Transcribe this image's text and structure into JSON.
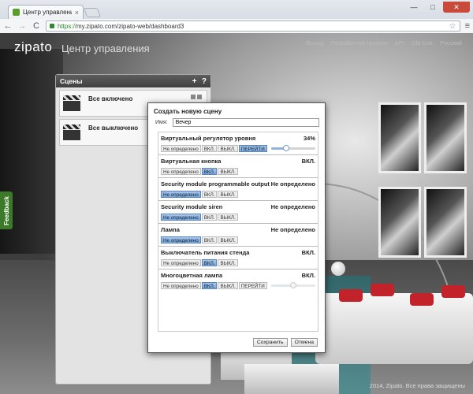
{
  "browser": {
    "tab_title": "Центр управления",
    "tab_close": "×",
    "window_controls": [
      "—",
      "□",
      "✕"
    ],
    "nav": {
      "back": "←",
      "forward": "→",
      "reload": "C"
    },
    "url_scheme": "https://",
    "url_rest": "my.zipato.com/zipato-web/dashboard3",
    "star": "☆",
    "menu": "≡"
  },
  "header": {
    "logo": "zipato",
    "subtitle": "Центр управления",
    "nav": [
      "Выход",
      "Разработчик прилож",
      "API",
      "Old look",
      "Русский"
    ]
  },
  "feedback_label": "Feedback",
  "scenes_panel": {
    "title": "Сцены",
    "add_icon": "+",
    "help_icon": "?",
    "items": [
      {
        "name": "Все включено"
      },
      {
        "name": "Все выключено"
      }
    ]
  },
  "dialog": {
    "title": "Создать новую сцену",
    "name_label": "Имя:",
    "name_value": "Вечер",
    "devices": [
      {
        "name": "Виртуальный регулятор уровня",
        "state": "34%",
        "buttons": [
          "Не определено",
          "ВКЛ.",
          "ВЫКЛ.",
          "ПЕРЕЙТИ"
        ],
        "active": 3,
        "slider": 0.34
      },
      {
        "name": "Виртуальная кнопка",
        "state": "ВКЛ.",
        "buttons": [
          "Не определено",
          "ВКЛ.",
          "ВЫКЛ."
        ],
        "active": 1
      },
      {
        "name": "Security module programmable output",
        "state": "Не определено",
        "buttons": [
          "Не определено",
          "ВКЛ.",
          "ВЫКЛ."
        ],
        "active": 0
      },
      {
        "name": "Security module siren",
        "state": "Не определено",
        "buttons": [
          "Не определено",
          "ВКЛ.",
          "ВЫКЛ."
        ],
        "active": 0
      },
      {
        "name": "Лампа",
        "state": "Не определено",
        "buttons": [
          "Не определено",
          "ВКЛ.",
          "ВЫКЛ."
        ],
        "active": 0
      },
      {
        "name": "Выключатель питания стенда",
        "state": "ВКЛ.",
        "buttons": [
          "Не определено",
          "ВКЛ.",
          "ВЫКЛ."
        ],
        "active": 1
      },
      {
        "name": "Многоцветная лампа",
        "state": "ВКЛ.",
        "buttons": [
          "Не определено",
          "ВКЛ.",
          "ВЫКЛ.",
          "ПЕРЕЙТИ"
        ],
        "active": 1,
        "slider": 0.5
      }
    ],
    "save_label": "Сохранить",
    "cancel_label": "Отмена"
  },
  "footer": "2014, Zipato. Все права защищены"
}
